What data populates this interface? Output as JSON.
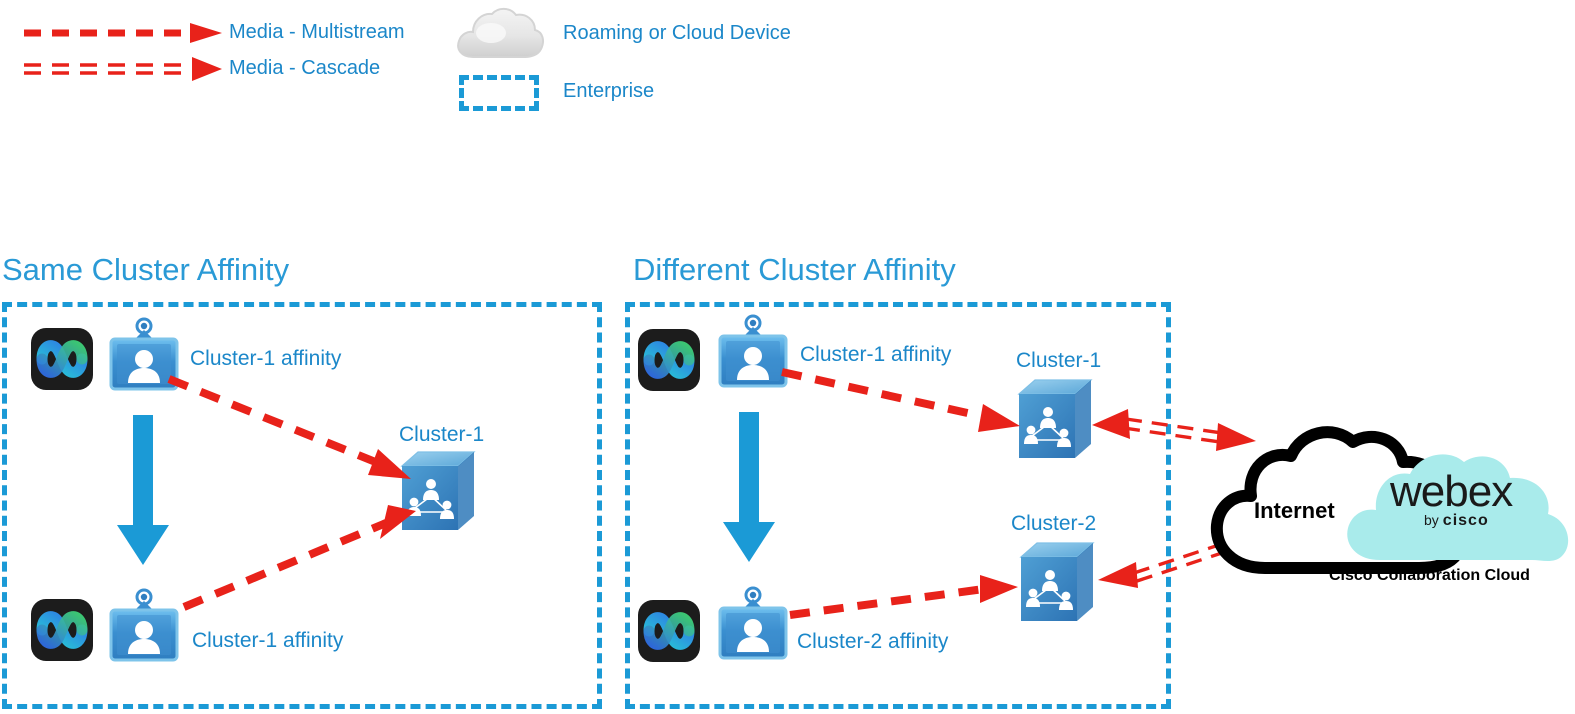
{
  "legend": {
    "items": [
      {
        "id": "media-multistream",
        "label": "Media - Multistream",
        "style": "single-dashed-arrow",
        "color": "#e8221a"
      },
      {
        "id": "media-cascade",
        "label": "Media - Cascade",
        "style": "double-dashed-arrow",
        "color": "#e8221a"
      },
      {
        "id": "roaming-cloud-device",
        "label": "Roaming or Cloud Device",
        "style": "gray-cloud",
        "color": "#cfcfcf"
      },
      {
        "id": "enterprise",
        "label": "Enterprise",
        "style": "blue-dashed-box",
        "color": "#1b9ad6"
      }
    ]
  },
  "sections": [
    {
      "id": "same-cluster-affinity",
      "title": "Same Cluster Affinity",
      "endpoints": [
        {
          "id": "endpoint-top",
          "icon": "webex-app-icon",
          "badge": "user-badge-icon",
          "label": "Cluster-1 affinity"
        },
        {
          "id": "endpoint-bottom",
          "icon": "webex-app-icon",
          "badge": "user-badge-icon",
          "label": "Cluster-1 affinity"
        }
      ],
      "clusters": [
        {
          "id": "cluster-1",
          "label": "Cluster-1",
          "icon": "cluster-server-icon"
        }
      ],
      "roam_arrow": {
        "id": "roaming-arrow",
        "direction": "down",
        "color": "#1b9ad6"
      }
    },
    {
      "id": "different-cluster-affinity",
      "title": "Different Cluster Affinity",
      "endpoints": [
        {
          "id": "endpoint-top",
          "icon": "webex-app-icon",
          "badge": "user-badge-icon",
          "label": "Cluster-1 affinity"
        },
        {
          "id": "endpoint-bottom",
          "icon": "webex-app-icon",
          "badge": "user-badge-icon",
          "label": "Cluster-2 affinity"
        }
      ],
      "clusters": [
        {
          "id": "cluster-1",
          "label": "Cluster-1",
          "icon": "cluster-server-icon"
        },
        {
          "id": "cluster-2",
          "label": "Cluster-2",
          "icon": "cluster-server-icon"
        }
      ],
      "roam_arrow": {
        "id": "roaming-arrow",
        "direction": "down",
        "color": "#1b9ad6"
      }
    }
  ],
  "cloud": {
    "internet_label": "Internet",
    "webex_wordmark": "webex",
    "webex_byline_prefix": "by",
    "webex_byline_brand": "cisco",
    "caption": "Cisco Collaboration Cloud",
    "internet_outline_color": "#000000",
    "webex_cloud_color": "#a9ebeb"
  },
  "colors": {
    "accent_blue": "#1b87c9",
    "dash_blue": "#1b9ad6",
    "media_red": "#e8221a",
    "heading_blue": "#2a9ad6",
    "webex_cyan": "#a9ebeb"
  }
}
